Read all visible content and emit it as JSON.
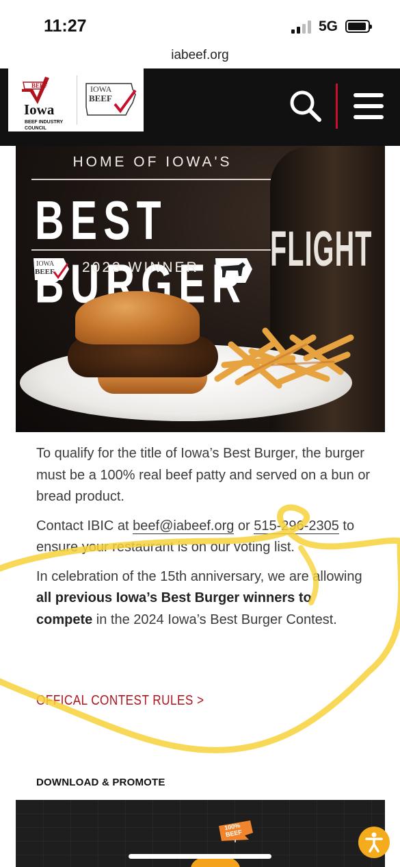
{
  "status_bar": {
    "time": "11:27",
    "network": "5G"
  },
  "browser": {
    "url": "iabeef.org"
  },
  "header": {
    "logo_left": {
      "beef_mark": "BEEF",
      "state": "Iowa",
      "org": "BEEF INDUSTRY COUNCIL"
    },
    "logo_right": {
      "line1": "IOWA",
      "line2": "BEEF"
    },
    "search_icon": "search-icon",
    "menu_icon": "hamburger-menu-icon"
  },
  "hero": {
    "kicker": "HOME OF IOWA'S",
    "title": "BEST BURGER",
    "winner": "2023 WINNER",
    "badge_left": {
      "line1": "IOWA",
      "line2": "BEEF"
    },
    "bottle_text": "FLIGHT"
  },
  "content": {
    "para1": "To qualify for the title of Iowa’s Best Burger, the burger must be a 100% real beef patty and served on a bun or bread product.",
    "para2_prefix": "Contact IBIC at ",
    "email": "beef@iabeef.org",
    "para2_mid": " or ",
    "phone": "515-296-2305",
    "para2_suffix": " to ensure your restaurant is on our voting list.",
    "para3_prefix": "In celebration of the 15th anniversary, we are allowing ",
    "para3_bold": "all previous Iowa’s Best Burger winners to compete",
    "para3_suffix": " in the 2024 Iowa’s Best Burger Contest.",
    "rules_link": "OFFICAL CONTEST RULES >"
  },
  "download": {
    "heading": "DOWNLOAD & PROMOTE",
    "flag_line1": "100%",
    "flag_line2": "BEEF"
  },
  "colors": {
    "brand_red": "#b0131d",
    "highlight_yellow": "#f7d23a",
    "accessibility_orange": "#f4ab1c"
  }
}
